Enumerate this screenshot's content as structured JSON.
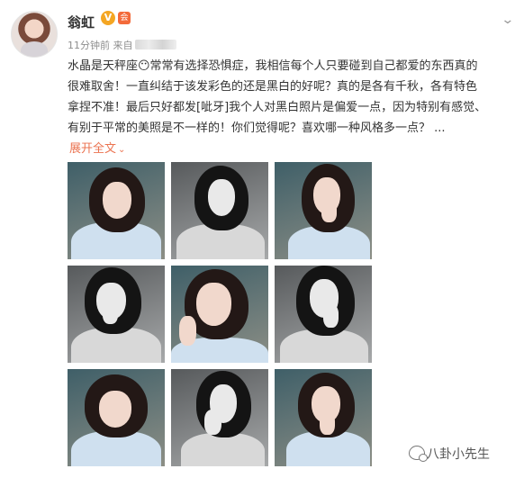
{
  "post": {
    "username": "翁虹",
    "verified_badge": "V",
    "member_badge": "会",
    "menu_icon": "chevron-down-icon",
    "time": "11分钟前",
    "source_prefix": "来自",
    "text": "水晶是天秤座😶常常有选择恐惧症，我相信每个人只要碰到自己都爱的东西真的\n很难取舍！一直纠结于该发彩色的还是黑白的好呢？真的是各有千秋，各有特色\n拿捏不准！最后只好都发[呲牙]我个人对黑白照片是偏爱一点，因为特别有感觉、\n有别于平常的美照是不一样的！你们觉得呢？喜欢哪一种风格多一点？ ...",
    "expand_label": "展开全文",
    "expand_icon": "chevron-down-icon",
    "accent_color": "#eb7350"
  },
  "photos": [
    {
      "label": "photo-1",
      "tone": "color"
    },
    {
      "label": "photo-2",
      "tone": "bw"
    },
    {
      "label": "photo-3",
      "tone": "color"
    },
    {
      "label": "photo-4",
      "tone": "bw"
    },
    {
      "label": "photo-5",
      "tone": "color"
    },
    {
      "label": "photo-6",
      "tone": "bw"
    },
    {
      "label": "photo-7",
      "tone": "color"
    },
    {
      "label": "photo-8",
      "tone": "bw"
    },
    {
      "label": "photo-9",
      "tone": "color"
    }
  ],
  "watermark": {
    "text": "八卦小先生",
    "icon": "wechat-icon"
  }
}
